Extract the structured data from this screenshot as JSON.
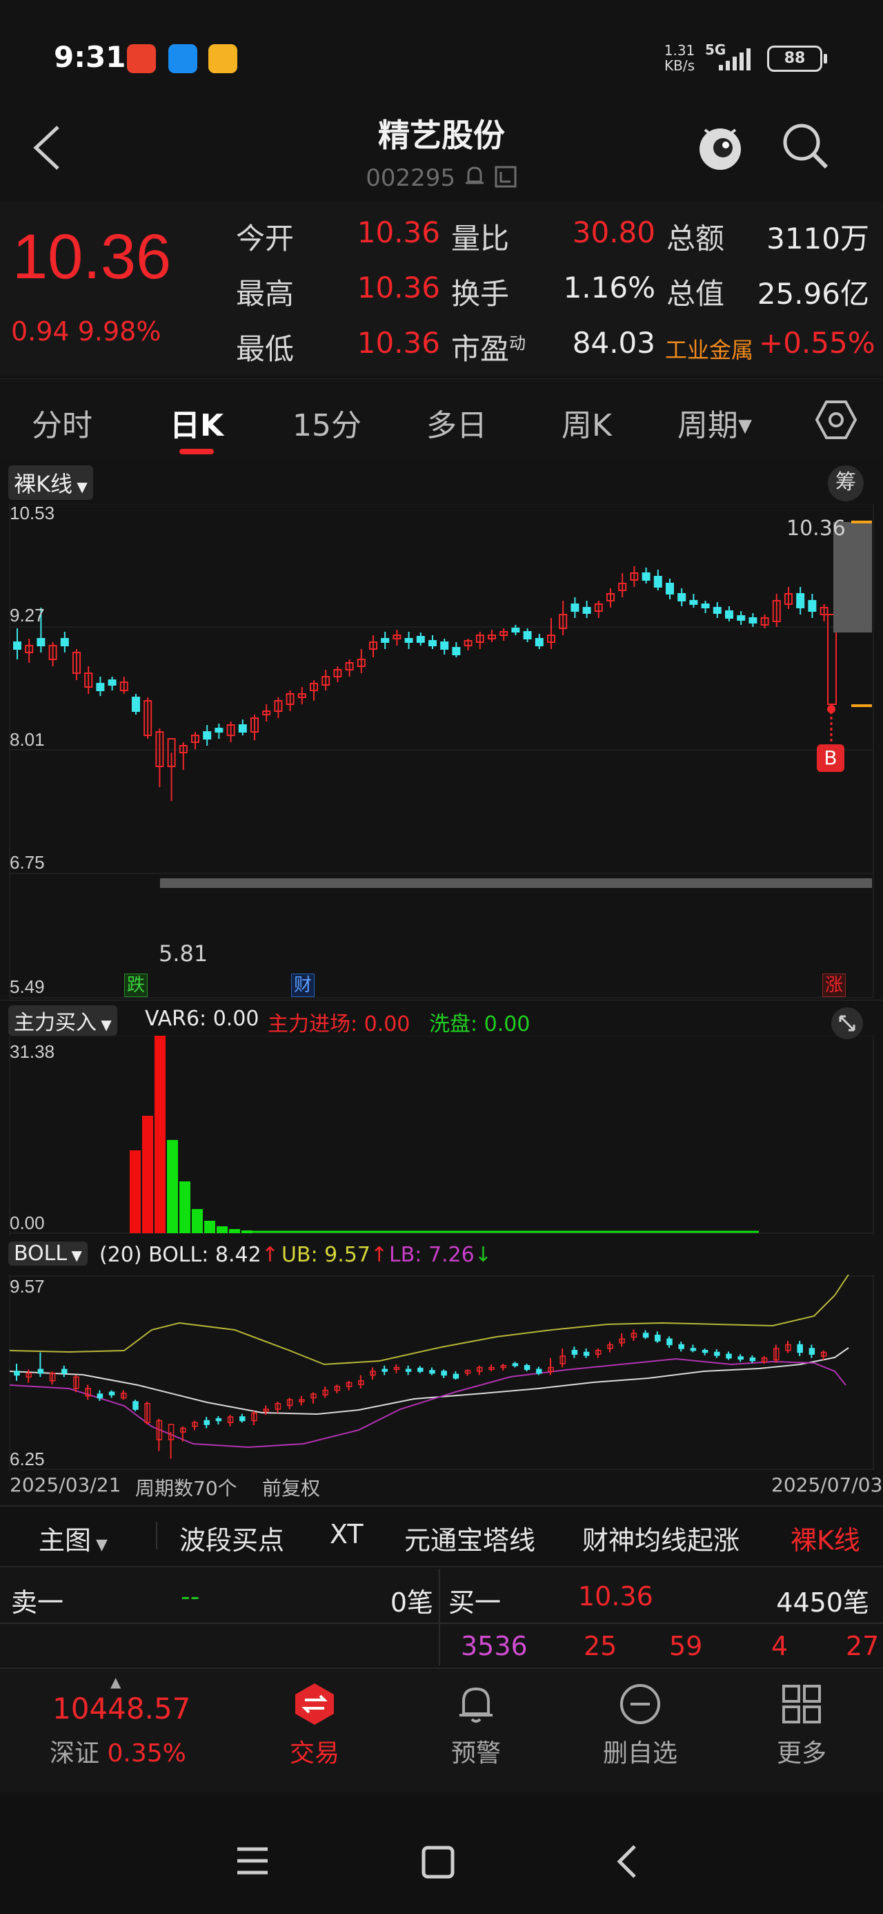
{
  "status_bar": {
    "time": "9:31",
    "net_speed_value": "1.31",
    "net_speed_unit": "KB/s",
    "network": "5G",
    "battery": "88",
    "apps": [
      "taobao-icon",
      "qq-browser-icon",
      "notes-icon"
    ]
  },
  "header": {
    "title": "精艺股份",
    "code": "002295"
  },
  "quote": {
    "price": "10.36",
    "change": "0.94",
    "change_pct": "9.98%",
    "fields": [
      {
        "label": "今开",
        "value": "10.36"
      },
      {
        "label": "最高",
        "value": "10.36"
      },
      {
        "label": "最低",
        "value": "10.36"
      },
      {
        "label": "量比",
        "value": "30.80"
      },
      {
        "label": "换手",
        "value": "1.16%"
      },
      {
        "label": "市盈",
        "sup": "动",
        "value": "84.03"
      },
      {
        "label": "总额",
        "value": "3110万"
      },
      {
        "label": "总值",
        "value": "25.96亿"
      },
      {
        "label": "工业金属",
        "value": "+0.55%"
      }
    ]
  },
  "tabs": [
    "分时",
    "日K",
    "15分",
    "多日",
    "周K",
    "周期"
  ],
  "active_tab": "日K",
  "main_chart": {
    "selector_label": "裸K线",
    "chip_label": "筹",
    "y_ticks": [
      "10.53",
      "9.27",
      "8.01",
      "6.75",
      "5.49"
    ],
    "last_price_label": "10.36",
    "low_label": "5.81",
    "markers": [
      "跌",
      "财",
      "涨"
    ],
    "buy_marker": "B"
  },
  "indicator1": {
    "selector_label": "主力买入",
    "var6": "VAR6: 0.00",
    "main_in": "主力进场: 0.00",
    "wash": "洗盘: 0.00",
    "y_top": "31.38",
    "y_bottom": "0.00"
  },
  "indicator2": {
    "selector_label": "BOLL",
    "params": "(20)",
    "boll": "BOLL: 8.42",
    "ub": "UB: 9.57",
    "lb": "LB: 7.26",
    "y_top": "9.57",
    "y_bottom": "6.25"
  },
  "date_axis": {
    "start": "2025/03/21",
    "period_count": "周期数70个",
    "adjust": "前复权",
    "end": "2025/07/03"
  },
  "indicator_menu": [
    "主图",
    "波段买点",
    "XT",
    "元通宝塔线",
    "财神均线起涨",
    "裸K线"
  ],
  "order_book": {
    "sell1_label": "卖一",
    "sell1_price": "-- ",
    "sell1_qty": "0笔",
    "buy1_label": "买一",
    "buy1_price": "10.36",
    "buy1_qty": "4450笔",
    "breakdown": [
      "3536",
      "25",
      "59",
      "4",
      "27"
    ]
  },
  "bottom_nav": {
    "index_value": "10448.57",
    "index_name": "深证",
    "index_change": "0.35%",
    "items": [
      "交易",
      "预警",
      "删自选",
      "更多"
    ]
  },
  "colors": {
    "up": "#f0262a",
    "down": "#3ce6ea",
    "accent": "#f0262a",
    "ub": "#d6d63a",
    "lb": "#c93fc9"
  }
}
